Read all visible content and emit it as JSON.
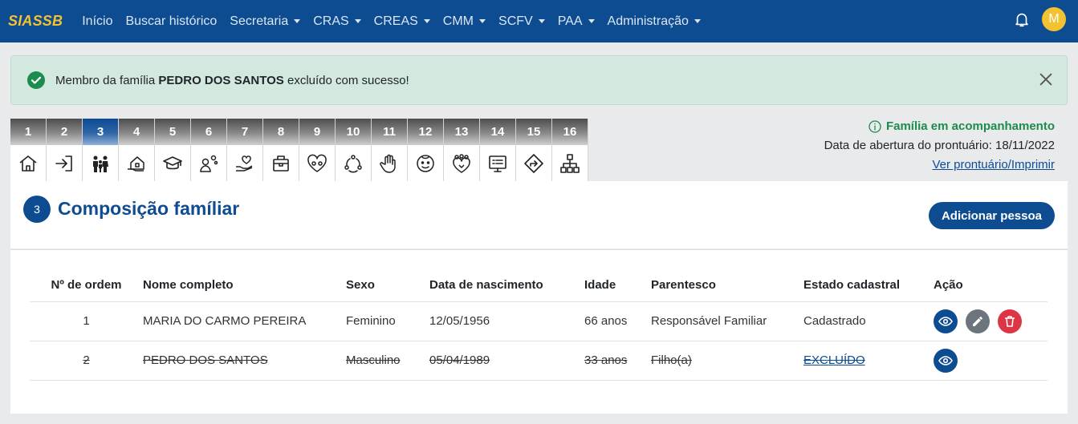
{
  "navbar": {
    "brand": "SIASSB",
    "items": [
      {
        "label": "Início",
        "dropdown": false
      },
      {
        "label": "Buscar histórico",
        "dropdown": false
      },
      {
        "label": "Secretaria",
        "dropdown": true
      },
      {
        "label": "CRAS",
        "dropdown": true
      },
      {
        "label": "CREAS",
        "dropdown": true
      },
      {
        "label": "CMM",
        "dropdown": true
      },
      {
        "label": "SCFV",
        "dropdown": true
      },
      {
        "label": "PAA",
        "dropdown": true
      },
      {
        "label": "Administração",
        "dropdown": true
      }
    ],
    "avatar_initial": "M"
  },
  "alert": {
    "prefix": "Membro da família",
    "name": "PEDRO DOS SANTOS",
    "suffix": "excluído com sucesso!"
  },
  "steps": [
    {
      "num": "1",
      "icon": "home-icon"
    },
    {
      "num": "2",
      "icon": "login-icon"
    },
    {
      "num": "3",
      "icon": "family-icon",
      "active": true
    },
    {
      "num": "4",
      "icon": "house-hand-icon"
    },
    {
      "num": "5",
      "icon": "graduation-cap-icon"
    },
    {
      "num": "6",
      "icon": "worker-gear-icon"
    },
    {
      "num": "7",
      "icon": "heart-hand-icon"
    },
    {
      "num": "8",
      "icon": "briefcase-icon"
    },
    {
      "num": "9",
      "icon": "heart-people-icon"
    },
    {
      "num": "10",
      "icon": "recycle-people-icon"
    },
    {
      "num": "11",
      "icon": "stop-hand-icon"
    },
    {
      "num": "12",
      "icon": "child-face-icon"
    },
    {
      "num": "13",
      "icon": "group-heart-icon"
    },
    {
      "num": "14",
      "icon": "screen-list-icon"
    },
    {
      "num": "15",
      "icon": "direction-sign-icon"
    },
    {
      "num": "16",
      "icon": "org-chart-icon"
    }
  ],
  "family_info": {
    "status": "Família em acompanhamento",
    "opening": "Data de abertura do prontuário: 18/11/2022",
    "print_link": "Ver prontuário/Imprimir"
  },
  "section": {
    "number": "3",
    "title": "Composição famíliar",
    "add_button": "Adicionar pessoa"
  },
  "table": {
    "headers": [
      "Nº de ordem",
      "Nome completo",
      "Sexo",
      "Data de nascimento",
      "Idade",
      "Parentesco",
      "Estado cadastral",
      "Ação"
    ],
    "rows": [
      {
        "ordem": "1",
        "nome": "MARIA DO CARMO PEREIRA",
        "sexo": "Feminino",
        "nascimento": "12/05/1956",
        "idade": "66 anos",
        "parentesco": "Responsável Familiar",
        "estado": "Cadastrado"
      },
      {
        "ordem": "2",
        "nome": "PEDRO DOS SANTOS",
        "sexo": "Masculino",
        "nascimento": "05/04/1989",
        "idade": "33 anos",
        "parentesco": "Filho(a)",
        "estado": "EXCLUÍDO"
      }
    ]
  },
  "colors": {
    "primary": "#0e4c92",
    "brand": "#f2c230",
    "success": "#1c8c4e",
    "danger": "#dc3545",
    "secondary": "#6c757d"
  }
}
